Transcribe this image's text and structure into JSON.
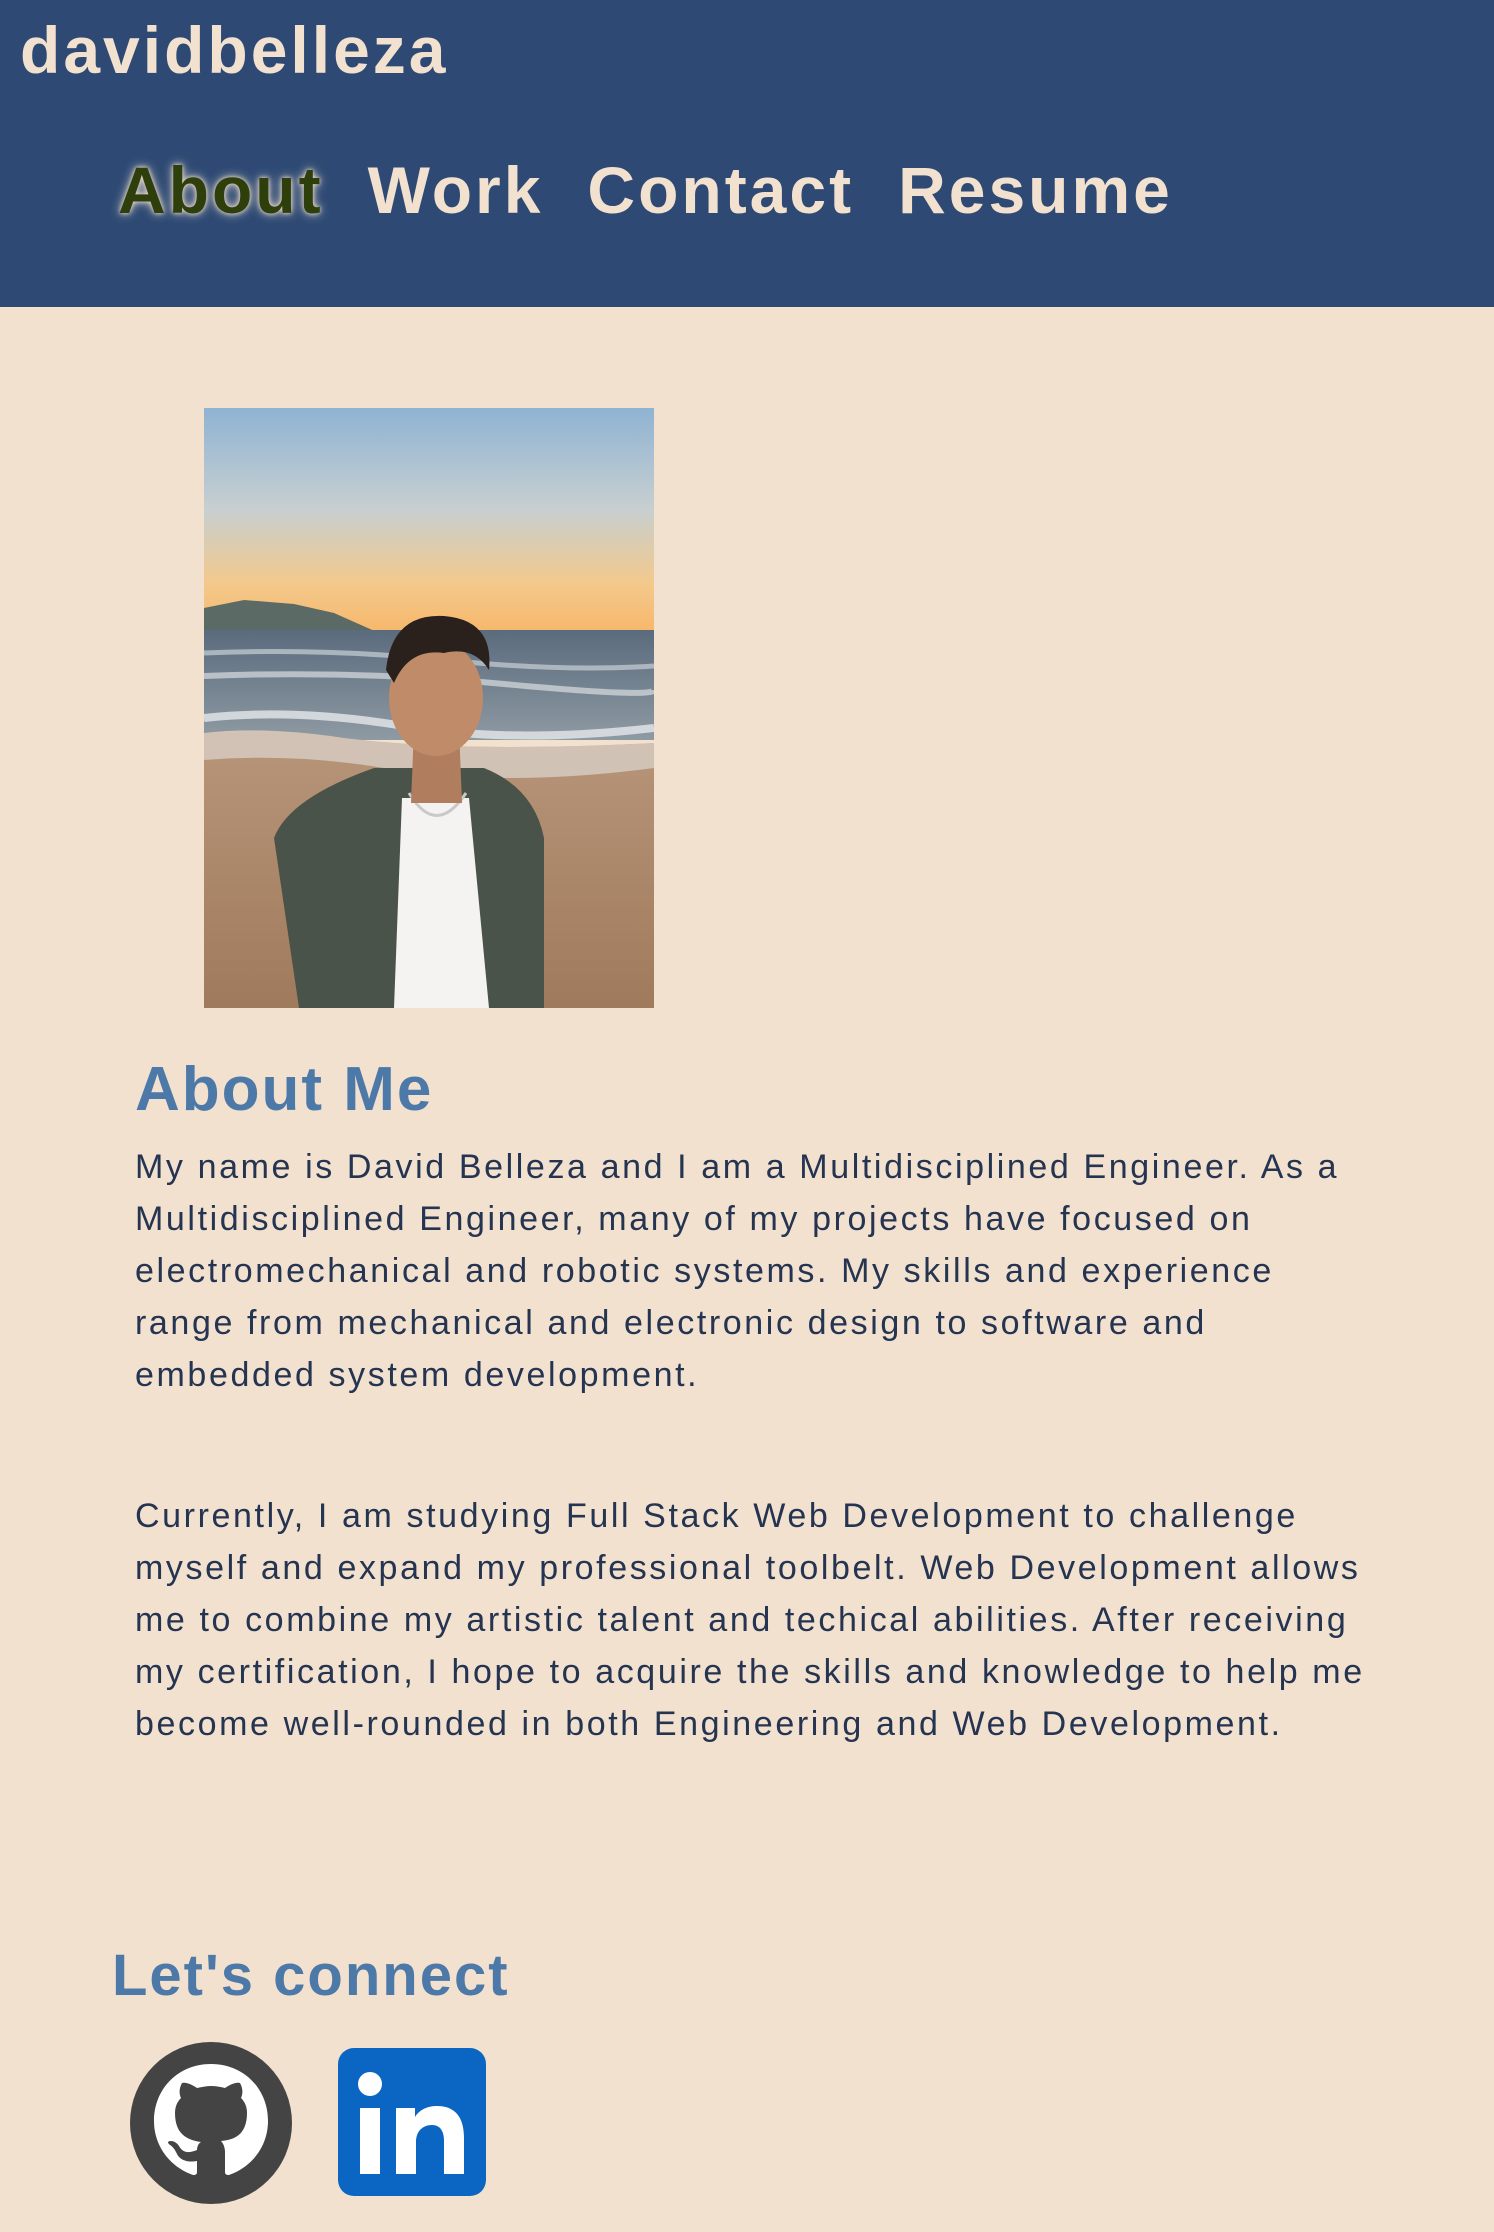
{
  "header": {
    "brand": "davidbelleza",
    "nav": [
      {
        "label": "About",
        "active": true
      },
      {
        "label": "Work"
      },
      {
        "label": "Contact"
      },
      {
        "label": "Resume"
      }
    ]
  },
  "about": {
    "title": "About Me",
    "paragraphs": [
      "My name is David Belleza and I am a Multidisciplined Engineer. As a Multidisciplined Engineer, many of my projects have focused on electromechanical and robotic systems. My skills and experience range from mechanical and electronic design to software and embedded system development.",
      "Currently, I am studying Full Stack Web Development to challenge myself and expand my professional toolbelt. Web Development allows me to combine my artistic talent and techical abilities. After receiving my certification, I hope to acquire the skills and knowledge to help me become well-rounded in both Engineering and Web Development."
    ]
  },
  "connect": {
    "title": "Let's connect",
    "links": [
      {
        "icon": "github-icon"
      },
      {
        "icon": "linkedin-icon",
        "text": "in"
      }
    ]
  },
  "colors": {
    "header_bg": "#2e4a74",
    "page_bg": "#f2e1cf",
    "accent": "#4d79a8",
    "body_text": "#253450",
    "active_nav": "#2f3f0c",
    "linkedin_blue": "#0a66c2"
  }
}
